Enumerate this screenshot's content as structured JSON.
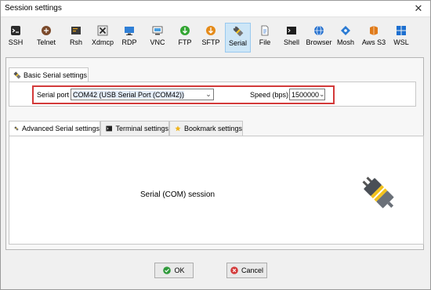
{
  "window": {
    "title": "Session settings",
    "close_glyph": "✕"
  },
  "toolbar": {
    "items": [
      {
        "label": "SSH",
        "icon": "ssh-icon"
      },
      {
        "label": "Telnet",
        "icon": "telnet-icon"
      },
      {
        "label": "Rsh",
        "icon": "rsh-icon"
      },
      {
        "label": "Xdmcp",
        "icon": "xdmcp-icon"
      },
      {
        "label": "RDP",
        "icon": "rdp-icon"
      },
      {
        "label": "VNC",
        "icon": "vnc-icon"
      },
      {
        "label": "FTP",
        "icon": "ftp-icon"
      },
      {
        "label": "SFTP",
        "icon": "sftp-icon"
      },
      {
        "label": "Serial",
        "icon": "serial-plug-icon",
        "selected": true
      },
      {
        "label": "File",
        "icon": "file-icon"
      },
      {
        "label": "Shell",
        "icon": "shell-icon"
      },
      {
        "label": "Browser",
        "icon": "browser-icon"
      },
      {
        "label": "Mosh",
        "icon": "mosh-icon"
      },
      {
        "label": "Aws S3",
        "icon": "aws-s3-icon"
      },
      {
        "label": "WSL",
        "icon": "wsl-icon"
      }
    ]
  },
  "basic_tab": {
    "label": "Basic Serial settings"
  },
  "serial_port": {
    "label": "Serial port *",
    "value": "COM42  (USB Serial Port (COM42))"
  },
  "speed": {
    "label": "Speed (bps) *",
    "value": "1500000"
  },
  "lower_tabs": [
    {
      "label": "Advanced Serial settings",
      "icon": "plug-icon"
    },
    {
      "label": "Terminal settings",
      "icon": "terminal-icon"
    },
    {
      "label": "Bookmark settings",
      "icon": "star-icon"
    }
  ],
  "content": {
    "session_text": "Serial (COM) session"
  },
  "buttons": {
    "ok_label": "OK",
    "cancel_label": "Cancel"
  },
  "colors": {
    "highlight": "#d33a3a",
    "selected_bg": "#cde6f7",
    "plug_yellow": "#f3c21b"
  }
}
